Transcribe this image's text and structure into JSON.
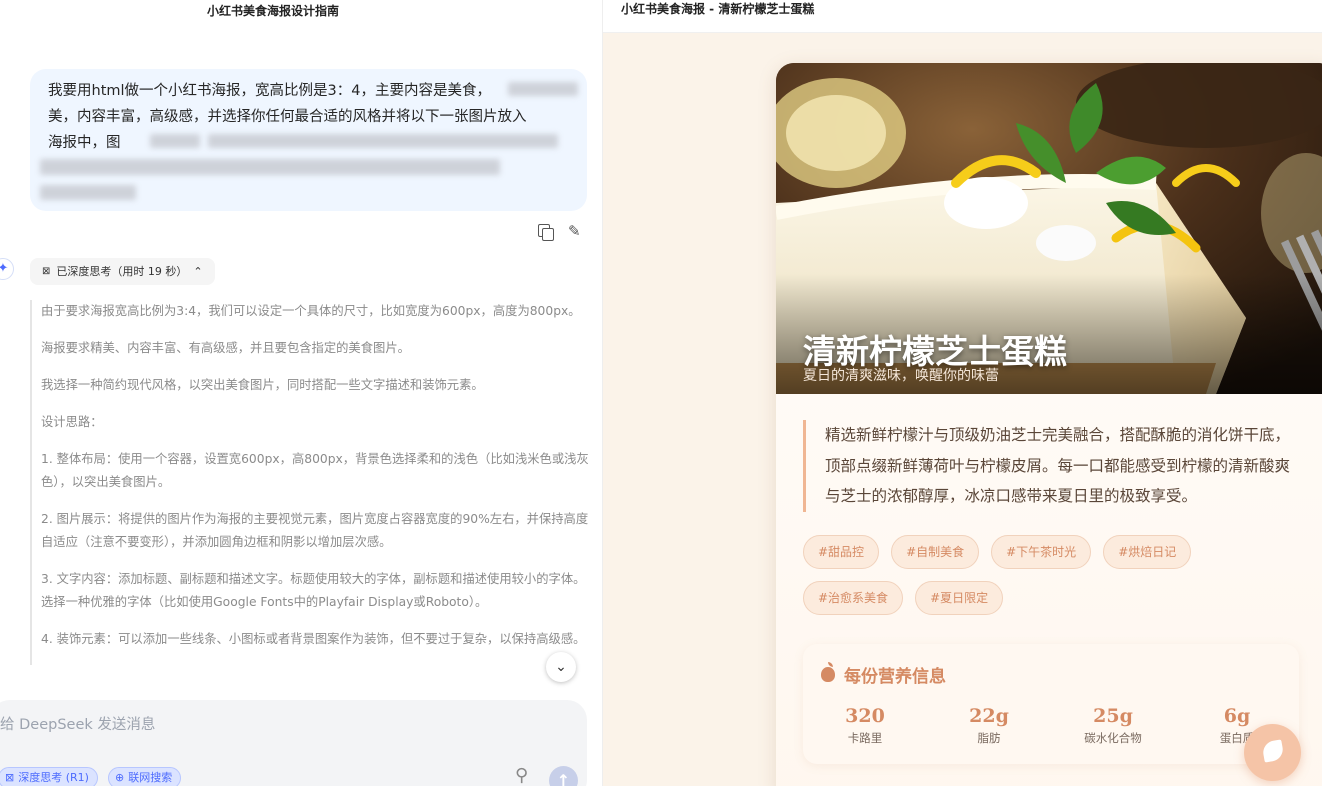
{
  "chat": {
    "title": "小红书美食海报设计指南",
    "user_message": "我要用html做一个小红书海报，宽高比例是3：4，主要内容是美食，",
    "user_message_line2": "美，内容丰富，高级感，并选择你任何最合适的风格并将以下一张图片放入",
    "user_message_line3": "海报中，图",
    "thinking_label": "已深度思考（用时 19 秒）",
    "thinking": [
      "由于要求海报宽高比例为3:4，我们可以设定一个具体的尺寸，比如宽度为600px，高度为800px。",
      "海报要求精美、内容丰富、有高级感，并且要包含指定的美食图片。",
      "我选择一种简约现代风格，以突出美食图片，同时搭配一些文字描述和装饰元素。",
      "设计思路：",
      "1. 整体布局：使用一个容器，设置宽600px，高800px，背景色选择柔和的浅色（比如浅米色或浅灰色），以突出美食图片。",
      "2. 图片展示：将提供的图片作为海报的主要视觉元素，图片宽度占容器宽度的90%左右，并保持高度自适应（注意不要变形），并添加圆角边框和阴影以增加层次感。",
      "3. 文字内容：添加标题、副标题和描述文字。标题使用较大的字体，副标题和描述使用较小的字体。选择一种优雅的字体（比如使用Google Fonts中的Playfair Display或Roboto）。",
      "4. 装饰元素：可以添加一些线条、小图标或者背景图案作为装饰，但不要过于复杂，以保持高级感。"
    ],
    "input_placeholder": "给 DeepSeek 发送消息",
    "deep_think_label": "深度思考 (R1)",
    "web_search_label": "联网搜索"
  },
  "preview": {
    "tab_title": "小红书美食海报 - 清新柠檬芝士蛋糕",
    "poster_title": "清新柠檬芝士蛋糕",
    "poster_subtitle": "夏日的清爽滋味，唤醒你的味蕾",
    "description": "精选新鲜柠檬汁与顶级奶油芝士完美融合，搭配酥脆的消化饼干底，顶部点缀新鲜薄荷叶与柠檬皮屑。每一口都能感受到柠檬的清新酸爽与芝士的浓郁醇厚，冰凉口感带来夏日里的极致享受。",
    "tags": [
      "#甜品控",
      "#自制美食",
      "#下午茶时光",
      "#烘焙日记",
      "#治愈系美食",
      "#夏日限定"
    ],
    "nutrition_title": "每份营养信息",
    "nutrition": [
      {
        "value": "320",
        "label": "卡路里"
      },
      {
        "value": "22g",
        "label": "脂肪"
      },
      {
        "value": "25g",
        "label": "碳水化合物"
      },
      {
        "value": "6g",
        "label": "蛋白质"
      }
    ],
    "accent_color": "#d58a63"
  }
}
